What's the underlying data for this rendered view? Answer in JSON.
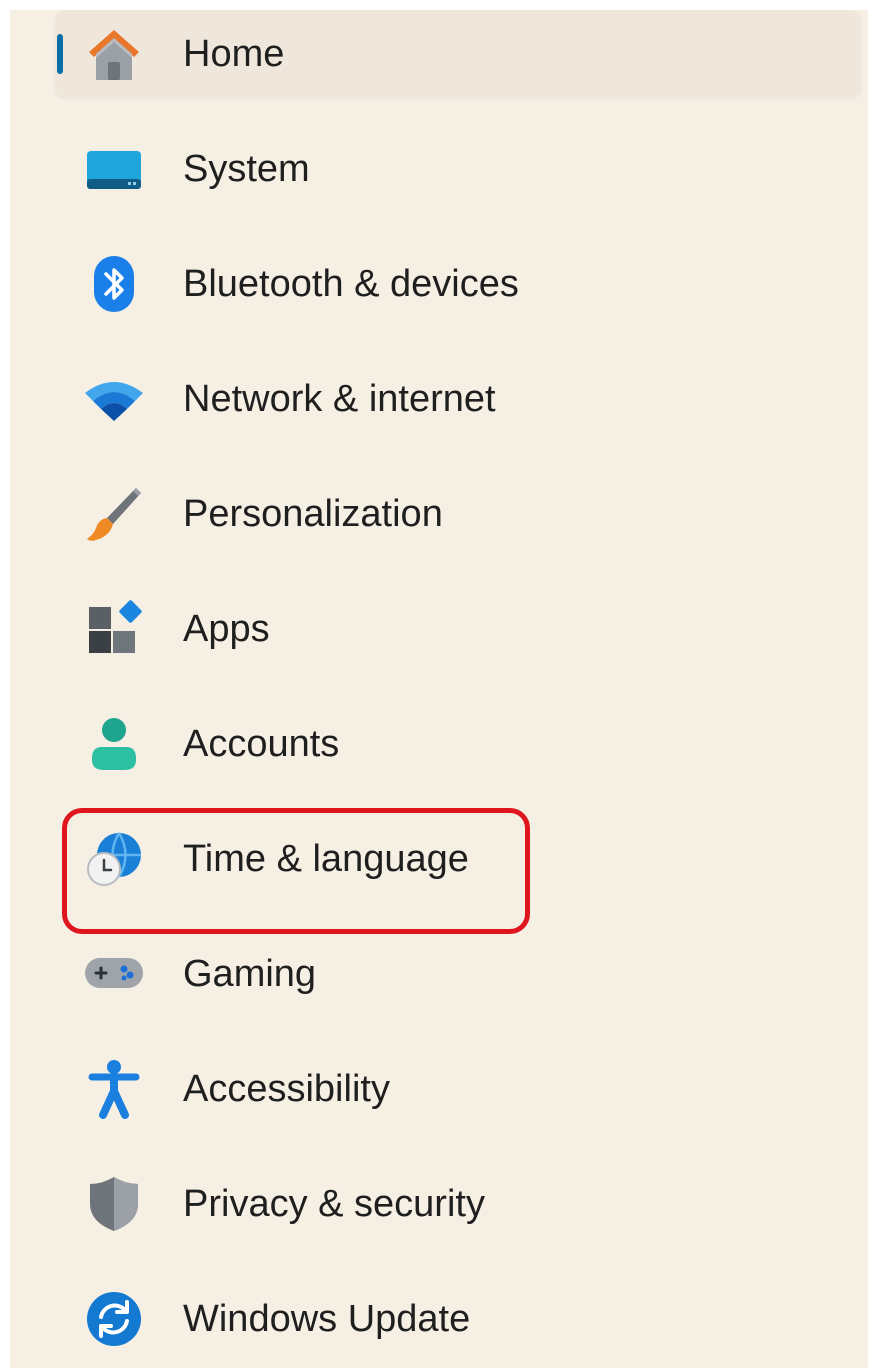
{
  "nav": {
    "items": [
      {
        "label": "Home",
        "icon": "home-icon",
        "selected": true
      },
      {
        "label": "System",
        "icon": "system-icon"
      },
      {
        "label": "Bluetooth & devices",
        "icon": "bluetooth-icon"
      },
      {
        "label": "Network & internet",
        "icon": "wifi-icon"
      },
      {
        "label": "Personalization",
        "icon": "paintbrush-icon"
      },
      {
        "label": "Apps",
        "icon": "apps-icon"
      },
      {
        "label": "Accounts",
        "icon": "person-icon"
      },
      {
        "label": "Time & language",
        "icon": "globe-clock-icon",
        "highlighted": true
      },
      {
        "label": "Gaming",
        "icon": "gamepad-icon"
      },
      {
        "label": "Accessibility",
        "icon": "accessibility-icon"
      },
      {
        "label": "Privacy & security",
        "icon": "shield-icon"
      },
      {
        "label": "Windows Update",
        "icon": "sync-icon"
      }
    ]
  },
  "colors": {
    "panel_background": "#f6efe4",
    "selected_background": "#efe7dc",
    "selection_indicator": "#0c6ea6",
    "highlight_border": "#e0161f"
  }
}
